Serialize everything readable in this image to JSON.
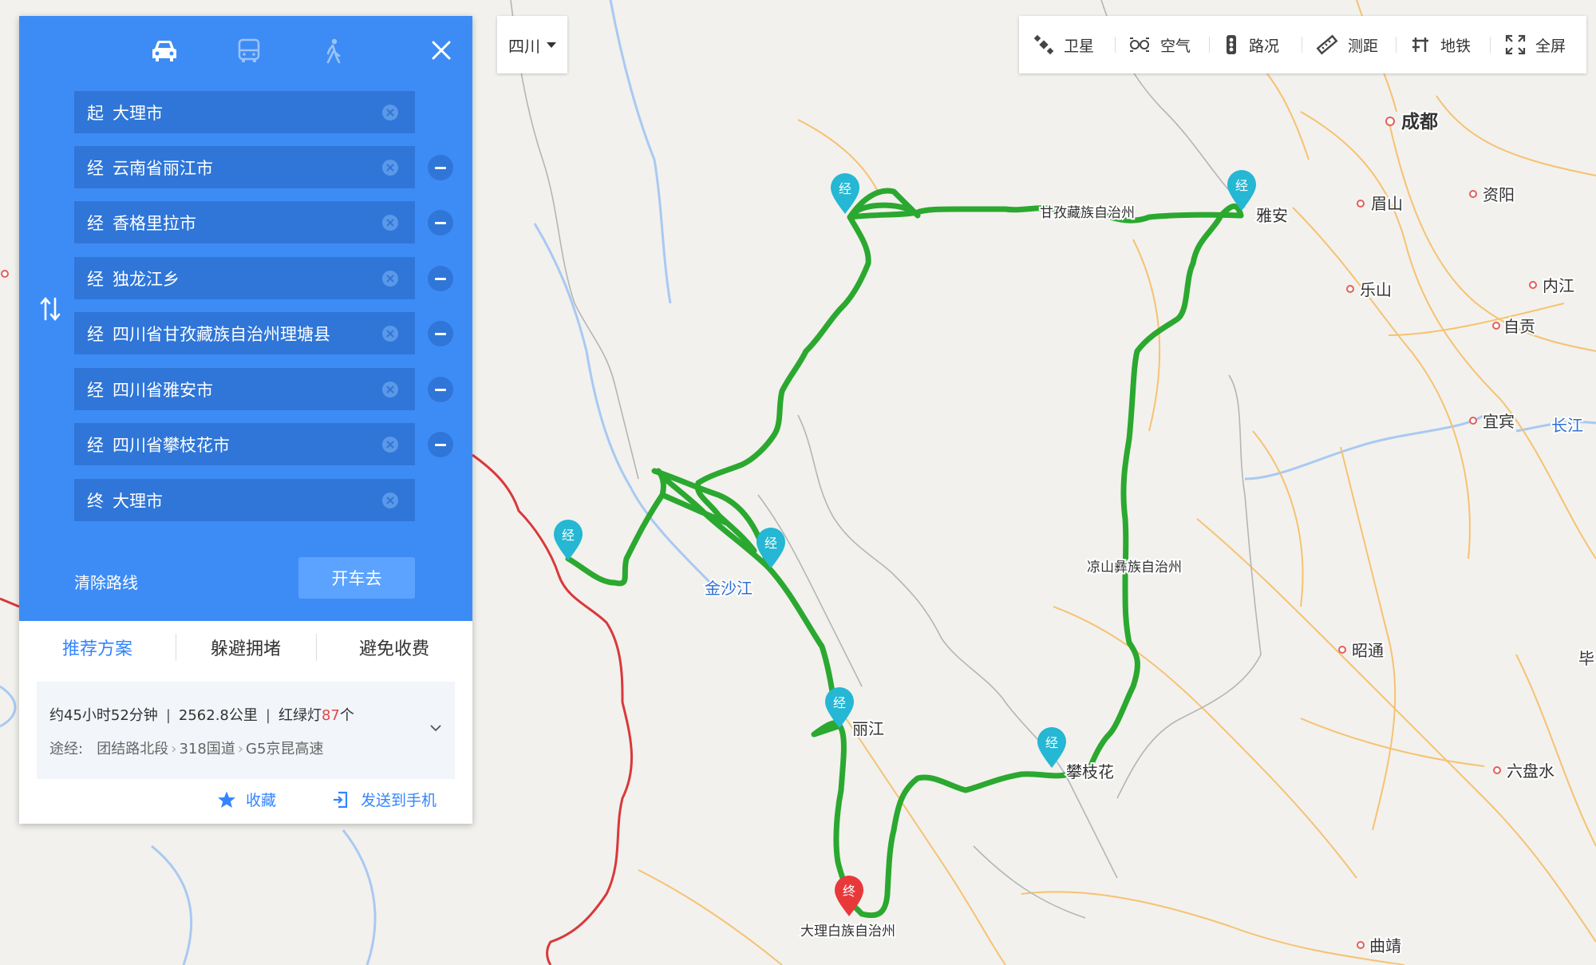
{
  "map": {
    "labels": {
      "chengdu": "成都",
      "meishan": "眉山",
      "ziyang": "资阳",
      "leshan": "乐山",
      "neijiang": "内江",
      "zigong": "自贡",
      "yibin": "宜宾",
      "changjiang": "长江",
      "yaan": "雅安",
      "ganzi": "甘孜藏族自治州",
      "liangshan": "凉山彝族自治州",
      "jinshajiang": "金沙江",
      "lijiang": "丽江",
      "panzhihua": "攀枝花",
      "zhaotong": "昭通",
      "liupanshui": "六盘水",
      "qujing": "曲靖",
      "bi": "毕",
      "dali": "大理白族自治州"
    },
    "markers": {
      "via": "经",
      "end": "终"
    },
    "colors": {
      "route": "#2ba82f",
      "border": "#d9383b",
      "road": "#f5b24a",
      "river": "#9bc3f0"
    }
  },
  "panel": {
    "modes": [
      "car-icon",
      "bus-icon",
      "walk-icon"
    ],
    "waypoints": [
      {
        "prefix": "起",
        "value": "大理市"
      },
      {
        "prefix": "经",
        "value": "云南省丽江市"
      },
      {
        "prefix": "经",
        "value": "香格里拉市"
      },
      {
        "prefix": "经",
        "value": "独龙江乡"
      },
      {
        "prefix": "经",
        "value": "四川省甘孜藏族自治州理塘县"
      },
      {
        "prefix": "经",
        "value": "四川省雅安市"
      },
      {
        "prefix": "经",
        "value": "四川省攀枝花市"
      },
      {
        "prefix": "终",
        "value": "大理市"
      }
    ],
    "clear_label": "清除路线",
    "go_label": "开车去",
    "tabs": [
      "推荐方案",
      "躲避拥堵",
      "避免收费"
    ],
    "summary": {
      "time": "约45小时52分钟",
      "distance": "2562.8公里",
      "lights_prefix": "红绿灯",
      "lights_count": "87",
      "lights_suffix": "个",
      "via_label": "途经:",
      "via_roads": [
        "团结路北段",
        "318国道",
        "G5京昆高速"
      ]
    },
    "favorite_label": "收藏",
    "send_label": "发送到手机"
  },
  "toolbar": {
    "province": "四川",
    "tools": [
      "卫星",
      "空气",
      "路况",
      "测距",
      "地铁",
      "全屏"
    ]
  }
}
